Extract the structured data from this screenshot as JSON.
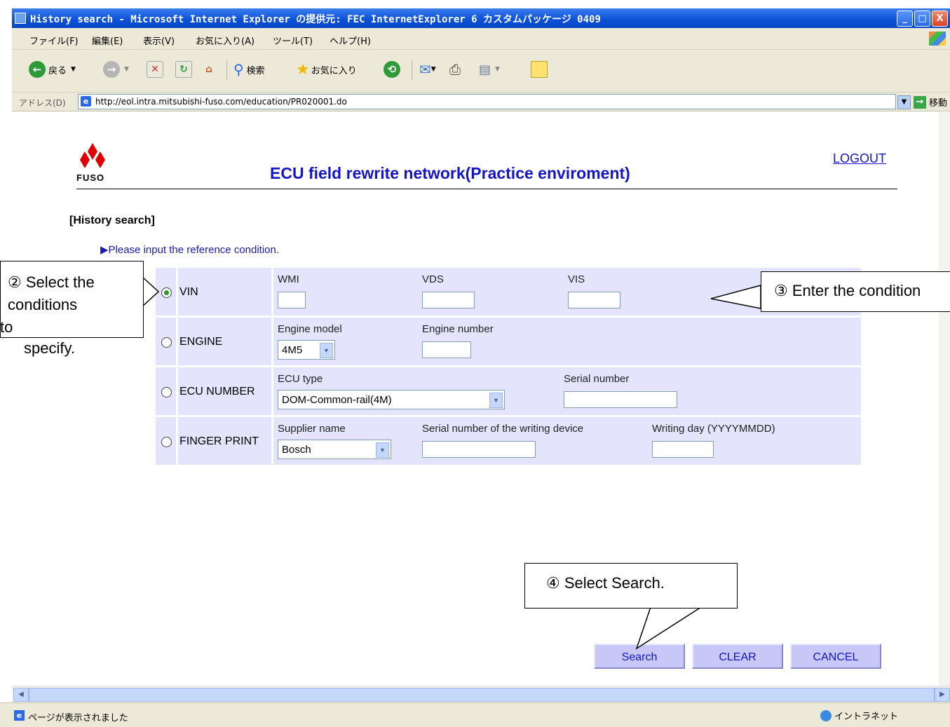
{
  "window": {
    "title": "History search - Microsoft Internet Explorer の提供元: FEC InternetExplorer 6 カスタムパッケージ 0409",
    "minimize": "_",
    "maximize": "□",
    "close": "X"
  },
  "menu": [
    "ファイル(F)",
    "編集(E)",
    "表示(V)",
    "お気に入り(A)",
    "ツール(T)",
    "ヘルプ(H)"
  ],
  "toolbar": {
    "back_label": "戻る",
    "search_label": "検索",
    "favorites_label": "お気に入り"
  },
  "address": {
    "label": "アドレス(D)",
    "url": "http://eol.intra.mitsubishi-fuso.com/education/PR020001.do",
    "go_label": "移動"
  },
  "page": {
    "logo_text": "FUSO",
    "title": "ECU field rewrite network(Practice enviroment)",
    "logout": "LOGOUT",
    "section": "[History search]",
    "hint": "▶Please input the reference condition."
  },
  "form": {
    "vin": {
      "label": "VIN",
      "selected": true,
      "wmi_label": "WMI",
      "vds_label": "VDS",
      "vis_label": "VIS",
      "wmi_value": "",
      "vds_value": "",
      "vis_value": ""
    },
    "engine": {
      "label": "ENGINE",
      "selected": false,
      "model_label": "Engine model",
      "model_value": "4M5",
      "number_label": "Engine number",
      "number_value": ""
    },
    "ecu": {
      "label": "ECU NUMBER",
      "selected": false,
      "type_label": "ECU type",
      "type_value": "DOM-Common-rail(4M)",
      "serial_label": "Serial number",
      "serial_value": ""
    },
    "finger": {
      "label": "FINGER PRINT",
      "selected": false,
      "supplier_label": "Supplier name",
      "supplier_value": "Bosch",
      "device_label": "Serial number of the writing device",
      "device_value": "",
      "day_label": "Writing day (YYYYMMDD)",
      "day_value": ""
    }
  },
  "buttons": {
    "search": "Search",
    "clear": "CLEAR",
    "cancel": "CANCEL"
  },
  "callouts": {
    "select": "② Select the conditions",
    "select_stray": "to",
    "select_tail": "specify.",
    "enter": "③ Enter the condition",
    "search": "④ Select Search."
  },
  "status": {
    "text": "ページが表示されました",
    "zone": "イントラネット"
  },
  "colors": {
    "link": "#1414c8",
    "row_bg": "#e4e4fc",
    "button_bg": "#c8c8f8",
    "titlebar": "#0a4fd6"
  }
}
